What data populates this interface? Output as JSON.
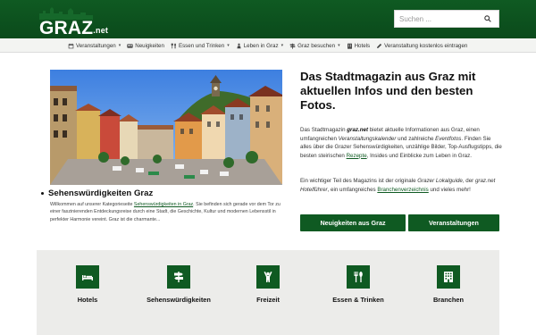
{
  "header": {
    "logo_main": "GRAZ",
    "logo_suffix": ".net",
    "search_placeholder": "Suchen ..."
  },
  "nav": {
    "items": [
      {
        "label": "Veranstaltungen",
        "icon": "calendar-icon",
        "dropdown": true
      },
      {
        "label": "Neuigkeiten",
        "icon": "newspaper-icon",
        "dropdown": false
      },
      {
        "label": "Essen und Trinken",
        "icon": "cutlery-icon",
        "dropdown": true
      },
      {
        "label": "Leben in Graz",
        "icon": "person-icon",
        "dropdown": true
      },
      {
        "label": "Graz besuchen",
        "icon": "signpost-icon",
        "dropdown": true
      },
      {
        "label": "Hotels",
        "icon": "hotel-icon",
        "dropdown": false
      },
      {
        "label": "Veranstaltung kostenlos eintragen",
        "icon": "pencil-icon",
        "dropdown": false
      }
    ]
  },
  "hero": {
    "caption_title": "Sehenswürdigkeiten Graz",
    "caption_text_1": "Willkommen auf unserer Kategorieseite ",
    "caption_link": "Sehenswürdigkeiten in Graz",
    "caption_text_2": ". Sie befinden sich gerade vor dem Tor zu einer faszinierenden Entdeckungsreise durch eine Stadt, die Geschichte, Kultur und modernen Lebensstil in perfekter Harmonie vereint. Graz ist die charmante..."
  },
  "intro": {
    "headline": "Das Stadtmagazin aus Graz mit aktuellen Infos und den besten Fotos.",
    "p1_a": "Das Stadtmagazin ",
    "p1_brand": "graz.net",
    "p1_b": " bietet aktuelle Informationen aus Graz, einen umfangreichen ",
    "p1_em1": "Veranstaltungskalender",
    "p1_c": " und zahlreiche ",
    "p1_em2": "Eventfotos",
    "p1_d": ". Finden Sie alles über die Grazer Sehenswürdigkeiten, unzählige Bilder, Top-Ausflugstipps, die besten steirischen ",
    "p1_link": "Rezepte",
    "p1_e": ", Insides und Einblicke zum Leben in Graz.",
    "p2_a": "Ein wichtiger Teil des Magazins ist der originale ",
    "p2_em1": "Grazer Lokalguide",
    "p2_b": ", der ",
    "p2_em2": "graz.net Hotelführer",
    "p2_c": ", ein umfangreiches ",
    "p2_link": "Branchenverzeichnis",
    "p2_d": " und vieles mehr!"
  },
  "buttons": {
    "news": "Neuigkeiten aus Graz",
    "events": "Veranstaltungen"
  },
  "categories": [
    {
      "label": "Hotels",
      "icon": "bed-icon"
    },
    {
      "label": "Sehenswürdigkeiten",
      "icon": "signpost-icon"
    },
    {
      "label": "Freizeit",
      "icon": "person-cheering-icon"
    },
    {
      "label": "Essen & Trinken",
      "icon": "cutlery-icon"
    },
    {
      "label": "Branchen",
      "icon": "building-icon"
    }
  ],
  "colors": {
    "brand_green": "#0f5a22",
    "nav_bg": "#f3f4f2",
    "category_bg": "#ececea"
  }
}
